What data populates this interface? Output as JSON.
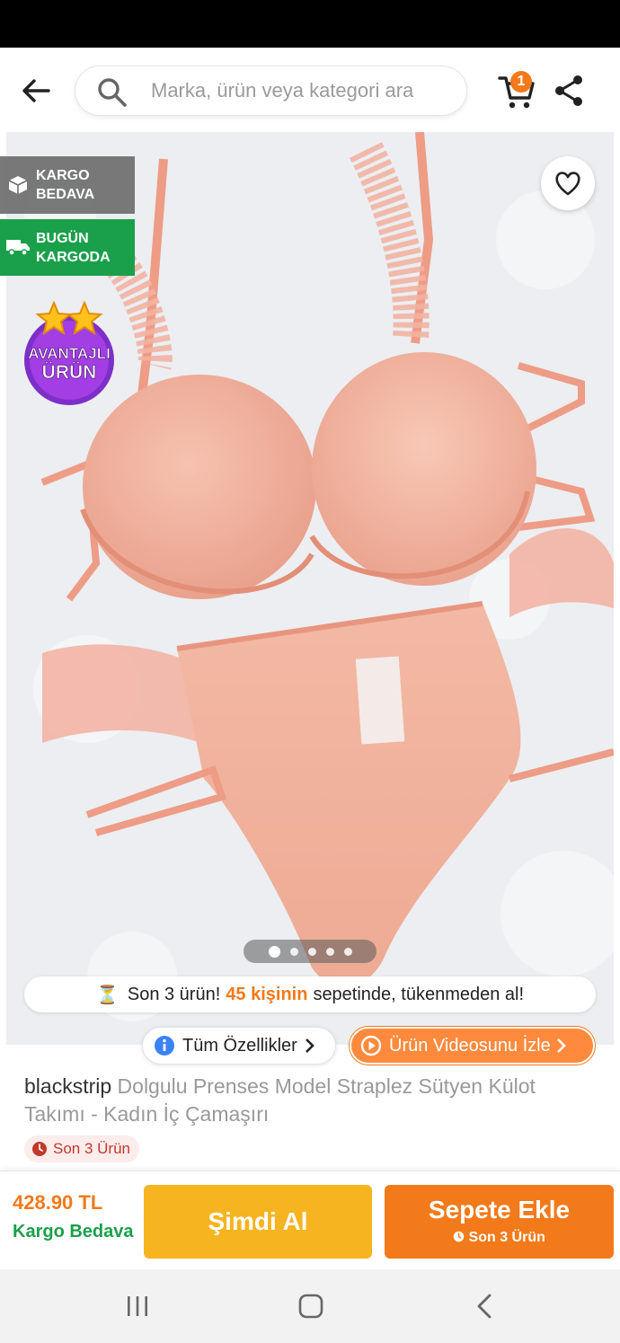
{
  "header": {
    "search": {
      "placeholder": "Marka, ürün veya kategori ara"
    },
    "cart_count": "1"
  },
  "gallery": {
    "badges": {
      "cargo_free": [
        "KARGO",
        "BEDAVA"
      ],
      "today_cargo": [
        "BUGÜN",
        "KARGODA"
      ],
      "advantage": [
        "AVANTAJLI",
        "ÜRÜN"
      ]
    },
    "dots": {
      "count": 5,
      "active_index": 0
    },
    "stock_banner": {
      "icon": "⏳",
      "part1": "Son 3 ürün!",
      "highlight": "45 kişinin",
      "part2": "sepetinde, tükenmeden al!"
    },
    "all_features_label": "Tüm Özellikler",
    "video_label": "Ürün Videosunu İzle"
  },
  "product": {
    "brand": "blackstrip",
    "name": "Dolgulu Prenses Model Straplez Sütyen Külot Takımı - Kadın İç Çamaşırı",
    "stock_chip": "Son 3 Ürün"
  },
  "bottom_bar": {
    "price": "428.90 TL",
    "cargo": "Kargo Bedava",
    "buy_now_label": "Şimdi Al",
    "add_to_cart_label": "Sepete Ekle",
    "add_to_cart_sub": "Son 3 Ürün"
  },
  "colors": {
    "accent": "#f27a1a",
    "green": "#1aa04a",
    "yellow": "#f6b420"
  },
  "icons": {
    "back": "arrow-left-icon",
    "search": "search-icon",
    "cart": "cart-icon",
    "share": "share-icon",
    "favorite": "heart-icon",
    "info": "info-icon",
    "play": "play-icon",
    "clock": "clock-icon"
  }
}
